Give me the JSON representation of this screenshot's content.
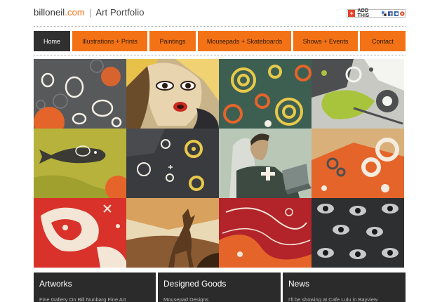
{
  "header": {
    "logo_domain": "billoneil",
    "logo_tld": ".com",
    "separator": "|",
    "section_title": "Art Portfolio",
    "share_label": "ADD THIS"
  },
  "nav": {
    "items": [
      {
        "label": "Home",
        "active": true
      },
      {
        "label": "Illustrations + Prints"
      },
      {
        "label": "Paintings"
      },
      {
        "label": "Mousepads + Skateboards"
      },
      {
        "label": "Shows + Events"
      },
      {
        "label": "Contact"
      }
    ]
  },
  "colors": {
    "accent": "#f47216",
    "dark": "#303030",
    "box_bg": "#2b2b2b"
  },
  "gallery": {
    "tiles": [
      "circles-pattern-gray",
      "surprised-woman",
      "green-circles-pattern",
      "splatter-green-gray",
      "fish-yellow",
      "dark-circles",
      "man-with-laptop",
      "orange-rings",
      "red-dragon-pattern",
      "deer-silhouette",
      "red-abstract-lines",
      "eyes-pattern"
    ]
  },
  "bottom": {
    "artworks_title": "Artworks",
    "artworks_text": "Fine Gallery On Bill Nunbarg Fine Art",
    "goods_title": "Designed Goods",
    "goods_text": "Mousepad Designs",
    "news_title": "News",
    "news_text": "I'll be showing at Cafe Lulu in Bayview"
  }
}
